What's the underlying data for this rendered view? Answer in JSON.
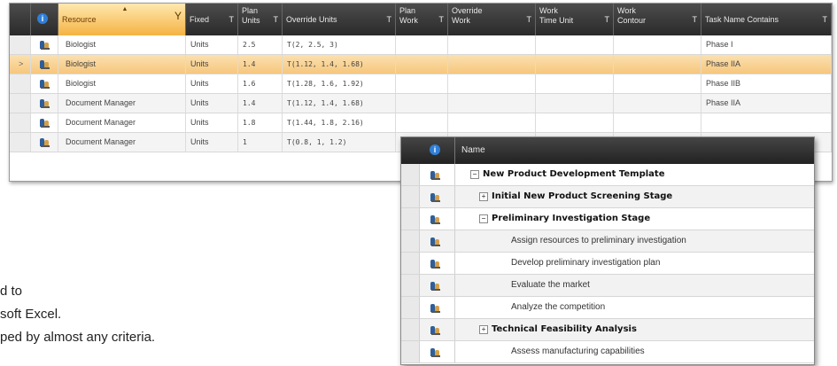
{
  "grid1": {
    "columns": [
      {
        "label": "",
        "filter": ""
      },
      {
        "label": "",
        "filter": ""
      },
      {
        "label": "Resource",
        "filter": "Y"
      },
      {
        "label": "Fixed",
        "filter": "T"
      },
      {
        "label": "Plan\nUnits",
        "filter": "T"
      },
      {
        "label": "Override Units",
        "filter": "T"
      },
      {
        "label": "Plan\nWork",
        "filter": "T"
      },
      {
        "label": "Override\nWork",
        "filter": "T"
      },
      {
        "label": "Work\nTime Unit",
        "filter": "T"
      },
      {
        "label": "Work\nContour",
        "filter": "T"
      },
      {
        "label": "Task Name Contains",
        "filter": "T"
      }
    ],
    "info_glyph": "i",
    "current_row_glyph": ">",
    "rows": [
      {
        "resource": "Biologist",
        "fixed": "Units",
        "plan_units": "2.5",
        "override_units": "T(2, 2.5, 3)",
        "task_name": "Phase I"
      },
      {
        "resource": "Biologist",
        "fixed": "Units",
        "plan_units": "1.4",
        "override_units": "T(1.12, 1.4, 1.68)",
        "task_name": "Phase IIA"
      },
      {
        "resource": "Biologist",
        "fixed": "Units",
        "plan_units": "1.6",
        "override_units": "T(1.28, 1.6, 1.92)",
        "task_name": "Phase IIB"
      },
      {
        "resource": "Document Manager",
        "fixed": "Units",
        "plan_units": "1.4",
        "override_units": "T(1.12, 1.4, 1.68)",
        "task_name": "Phase IIA"
      },
      {
        "resource": "Document Manager",
        "fixed": "Units",
        "plan_units": "1.8",
        "override_units": "T(1.44, 1.8, 2.16)",
        "task_name": ""
      },
      {
        "resource": "Document Manager",
        "fixed": "Units",
        "plan_units": "1",
        "override_units": "T(0.8, 1, 1.2)",
        "task_name": ""
      }
    ]
  },
  "background_text": {
    "line1": "d to",
    "line2": "soft Excel.",
    "line3": "ped by almost any criteria."
  },
  "grid2": {
    "header_name": "Name",
    "info_glyph": "i",
    "rows": [
      {
        "label": "New Product Development Template",
        "toggle": "−",
        "bold": true
      },
      {
        "label": "Initial New Product Screening Stage",
        "toggle": "+",
        "bold": true
      },
      {
        "label": "Preliminary Investigation Stage",
        "toggle": "−",
        "bold": true
      },
      {
        "label": "Assign resources to preliminary investigation",
        "toggle": "",
        "bold": false
      },
      {
        "label": "Develop preliminary investigation plan",
        "toggle": "",
        "bold": false
      },
      {
        "label": "Evaluate the market",
        "toggle": "",
        "bold": false
      },
      {
        "label": "Analyze the competition",
        "toggle": "",
        "bold": false
      },
      {
        "label": "Technical Feasibility Analysis",
        "toggle": "+",
        "bold": true
      },
      {
        "label": "Assess manufacturing capabilities",
        "toggle": "",
        "bold": false
      }
    ]
  },
  "colors": {
    "header_dark": "#333333",
    "selected_row": "#f6c77d",
    "active_header": "#f4b342",
    "info_blue": "#2f7fd8"
  },
  "icons": {
    "info": "info-icon",
    "resource": "resource-people-icon",
    "filter": "filter-icon",
    "expand": "expand-icon",
    "collapse": "collapse-icon"
  }
}
